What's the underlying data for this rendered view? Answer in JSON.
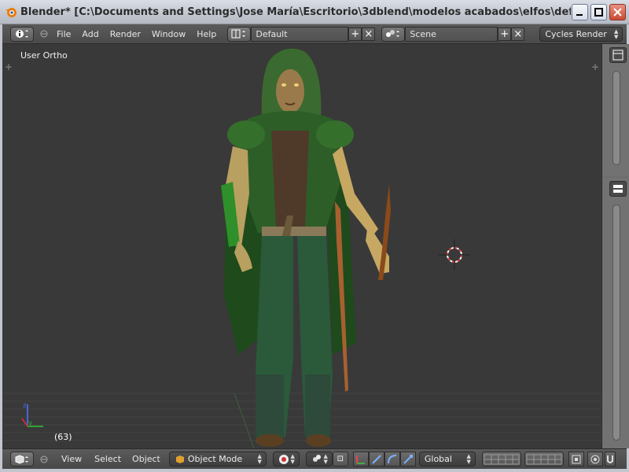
{
  "window": {
    "title": "Blender* [C:\\Documents and Settings\\Jose María\\Escritorio\\3dblend\\modelos acabados\\elfos\\definitivos\\boske..."
  },
  "info_header": {
    "menus": [
      "File",
      "Add",
      "Render",
      "Window",
      "Help"
    ],
    "layout_value": "Default",
    "scene_value": "Scene",
    "render_engine": "Cycles Render"
  },
  "viewport": {
    "view_label": "User Ortho",
    "frame_label": "(63)"
  },
  "view3d_header": {
    "menus": [
      "View",
      "Select",
      "Object"
    ],
    "mode": "Object Mode",
    "orientation": "Global"
  },
  "colors": {
    "viewport_bg": "#393939",
    "header_bg": "#4a4a4a",
    "cloak_green": "#2f6b2a"
  }
}
